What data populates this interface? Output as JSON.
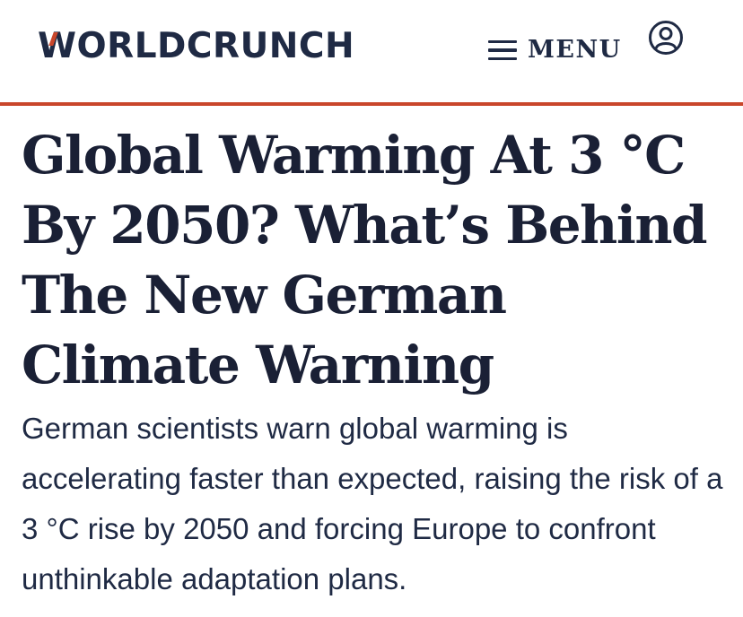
{
  "header": {
    "logo_text": "WORLDCRUNCH",
    "menu_label": "MENU",
    "menu_icon": "hamburger-menu-icon",
    "account_icon": "user-account-icon",
    "accent_color": "#c9462b",
    "text_color": "#1f2a44"
  },
  "article": {
    "headline": "Global Warming At 3 °C By 2050? What’s Behind The New German Climate Warning",
    "dek": "German scientists warn global warming is accelerating faster than expected, raising the risk of a 3 °C rise by 2050 and forcing Europe to confront unthinkable adaptation plans."
  }
}
